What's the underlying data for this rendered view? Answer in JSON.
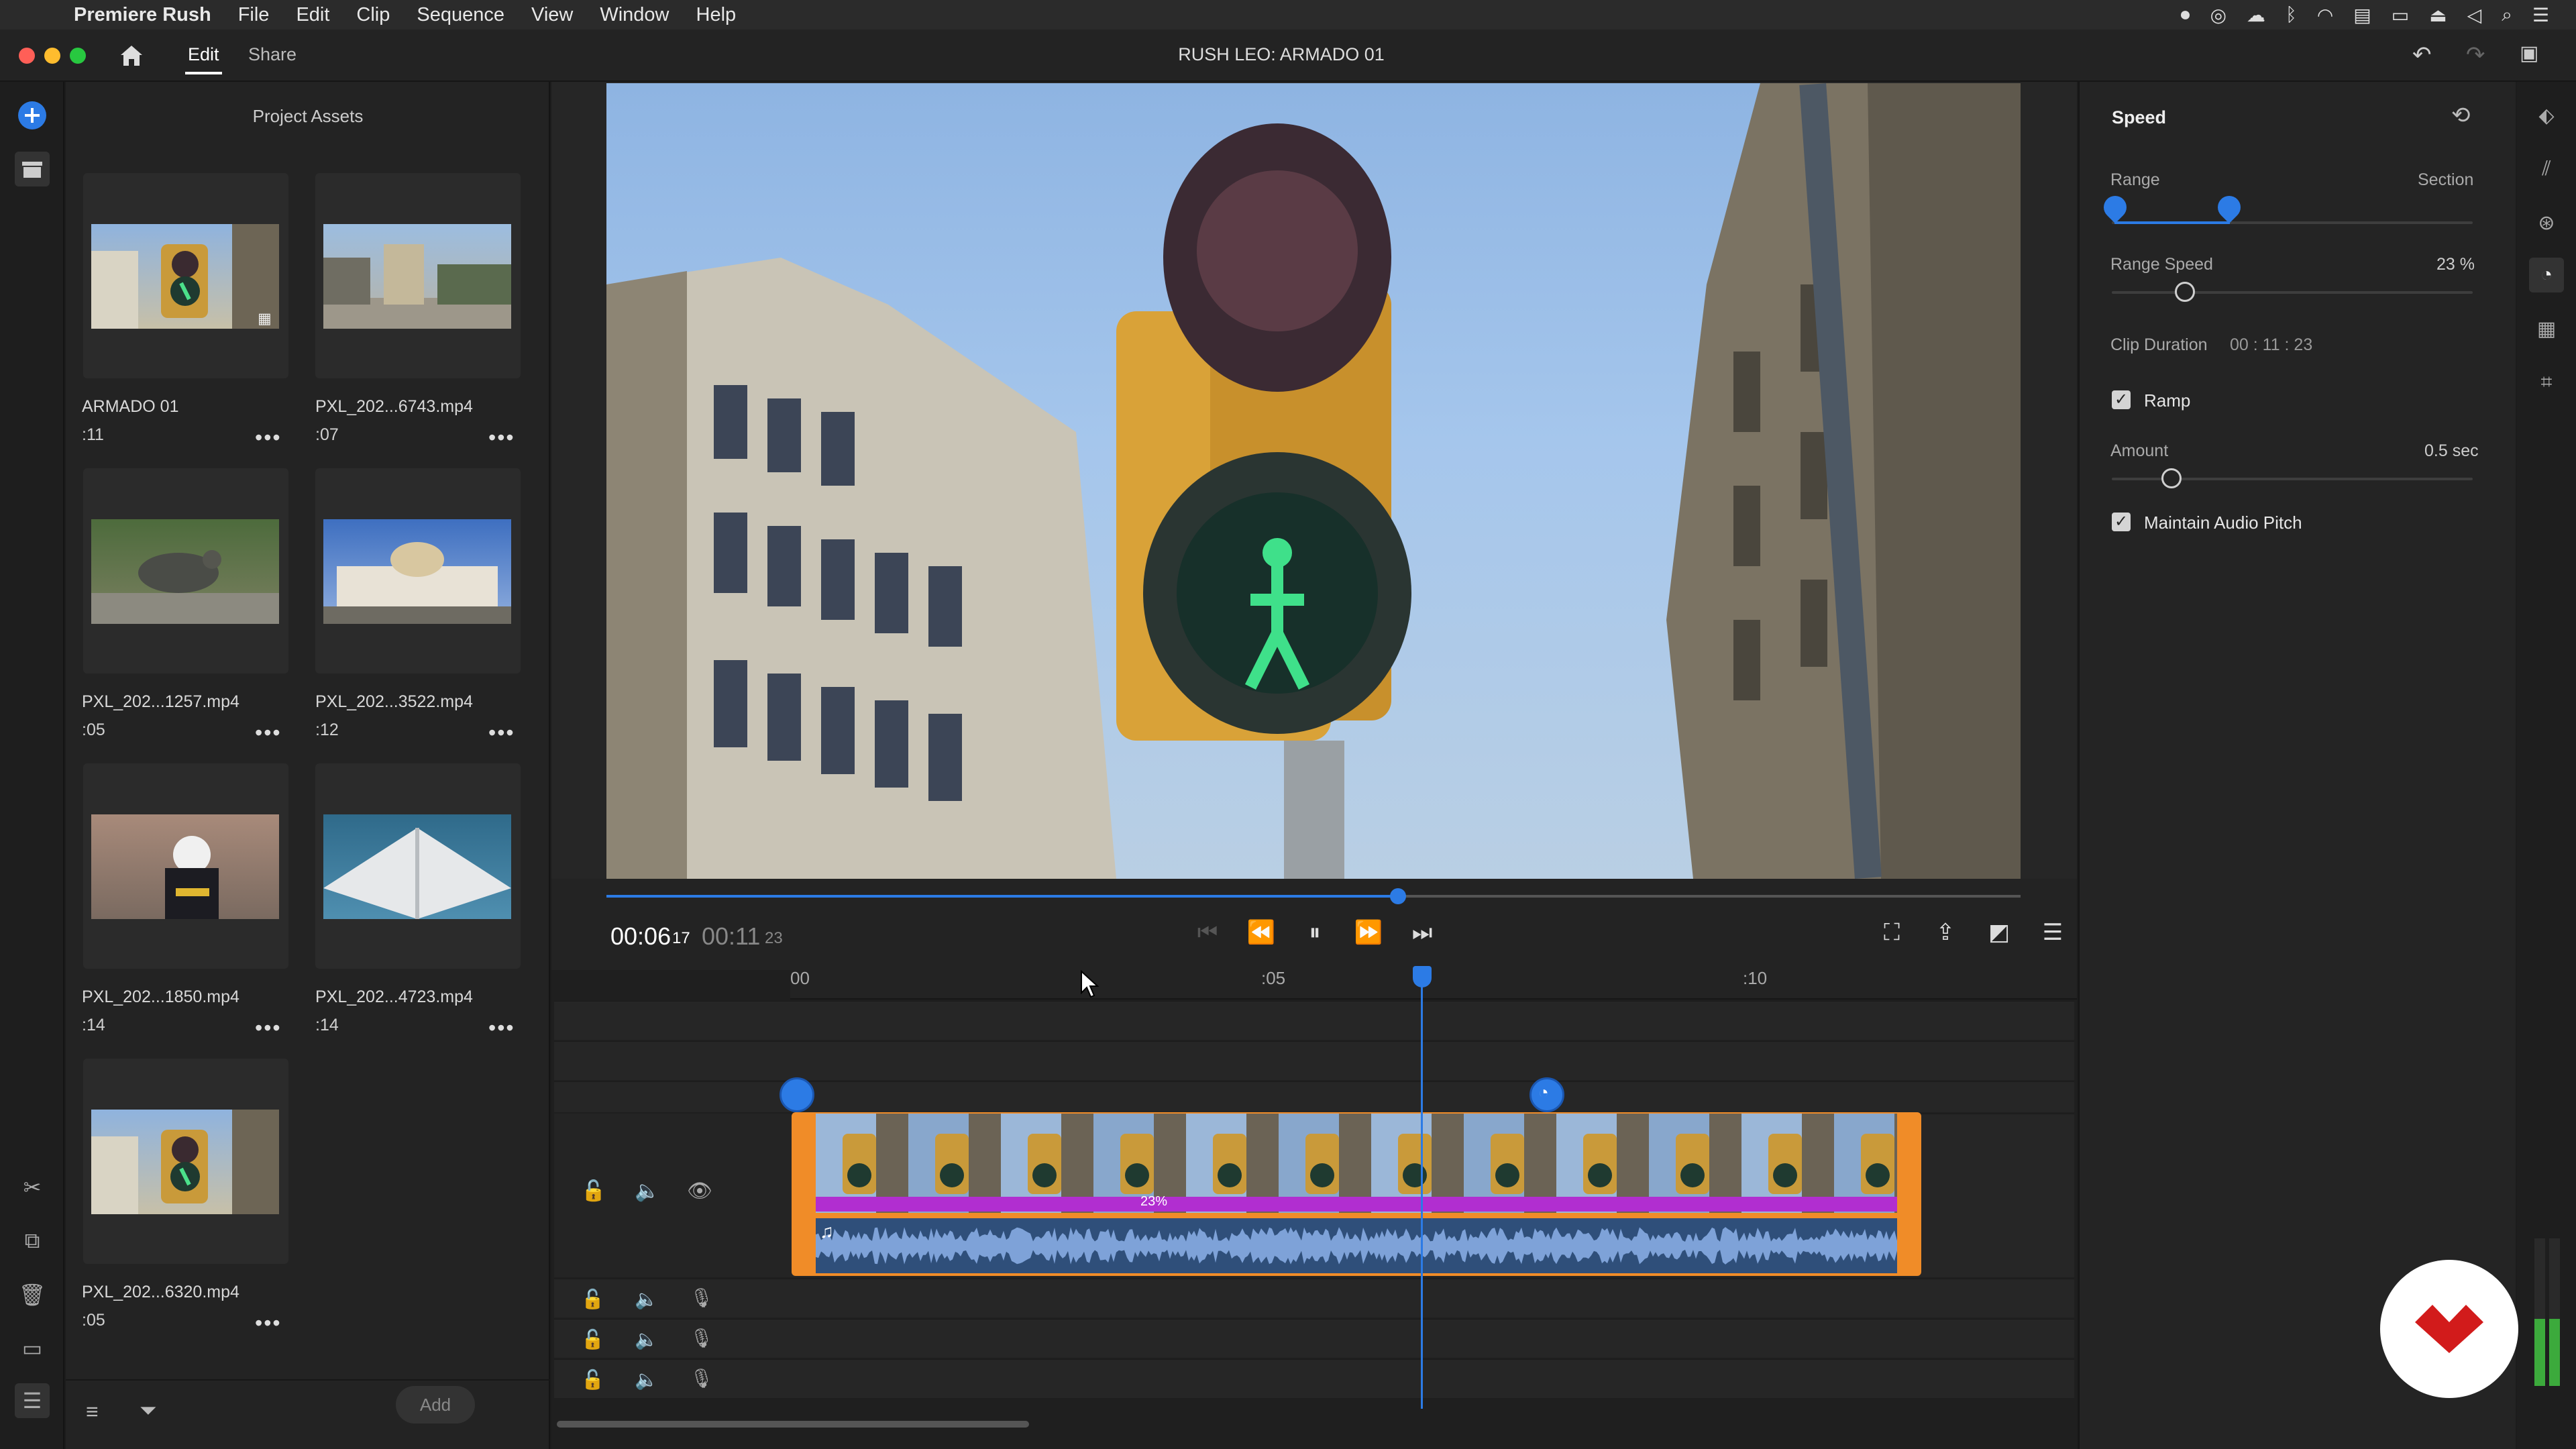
{
  "menubar": {
    "app_name": "Premiere Rush",
    "items": [
      "File",
      "Edit",
      "Clip",
      "Sequence",
      "View",
      "Window",
      "Help"
    ]
  },
  "titlebar": {
    "tabs": [
      "Edit",
      "Share"
    ],
    "document_title": "RUSH LEO: ARMADO 01"
  },
  "assets": {
    "title": "Project Assets",
    "add_label": "Add",
    "items": [
      {
        "name": "ARMADO 01",
        "duration": ":11"
      },
      {
        "name": "PXL_202...6743.mp4",
        "duration": ":07"
      },
      {
        "name": "PXL_202...1257.mp4",
        "duration": ":05"
      },
      {
        "name": "PXL_202...3522.mp4",
        "duration": ":12"
      },
      {
        "name": "PXL_202...1850.mp4",
        "duration": ":14"
      },
      {
        "name": "PXL_202...4723.mp4",
        "duration": ":14"
      },
      {
        "name": "PXL_202...6320.mp4",
        "duration": ":05"
      }
    ],
    "more_label": "•••"
  },
  "transport": {
    "current_time": "00:06",
    "current_frames": "17",
    "total_time": "00:11",
    "total_frames": "23",
    "scrub_progress": 0.56
  },
  "timeline": {
    "ruler_labels": [
      "00",
      ":05",
      ":10"
    ],
    "speed_label": "23%"
  },
  "speed_panel": {
    "title": "Speed",
    "range_label": "Range",
    "section_label": "Section",
    "range_speed_label": "Range Speed",
    "range_speed_value": "23 %",
    "clip_duration_label": "Clip Duration",
    "clip_duration_value": "00 : 11 : 23",
    "ramp_label": "Ramp",
    "amount_label": "Amount",
    "amount_value": "0.5 sec",
    "maintain_audio_label": "Maintain Audio Pitch",
    "check_glyph": "✓"
  }
}
